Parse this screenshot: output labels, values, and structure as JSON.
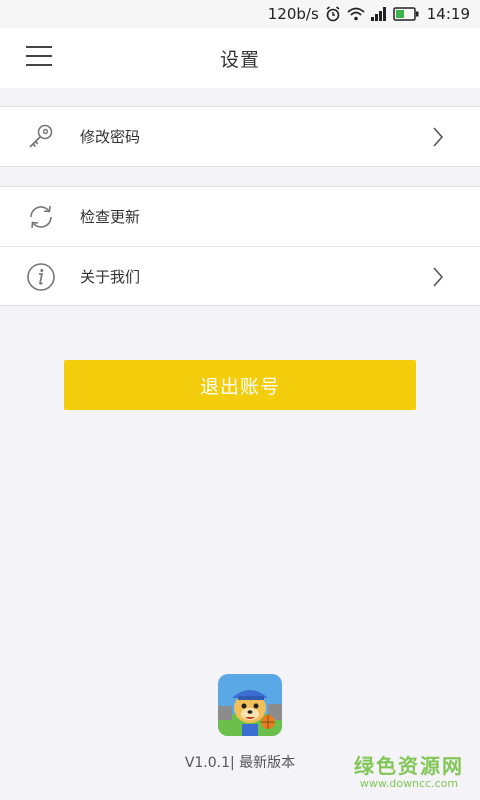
{
  "status_bar": {
    "speed": "120b/s",
    "time": "14:19",
    "icons": [
      "alarm-icon",
      "wifi-icon",
      "signal-icon",
      "battery-icon"
    ]
  },
  "header": {
    "title": "设置",
    "menu_icon": "hamburger-menu-icon"
  },
  "settings": {
    "group1": [
      {
        "label": "修改密码",
        "icon": "key-icon",
        "has_chevron": true
      }
    ],
    "group2": [
      {
        "label": "检查更新",
        "icon": "refresh-icon",
        "has_chevron": false
      },
      {
        "label": "关于我们",
        "icon": "info-icon",
        "has_chevron": true
      }
    ]
  },
  "logout_button": {
    "label": "退出账号",
    "color": "#f3cc0c"
  },
  "footer": {
    "logo_icon": "app-logo-icon",
    "version_text": "V1.0.1| 最新版本"
  },
  "watermark": {
    "main": "绿色资源网",
    "url": "www.downcc.com"
  }
}
